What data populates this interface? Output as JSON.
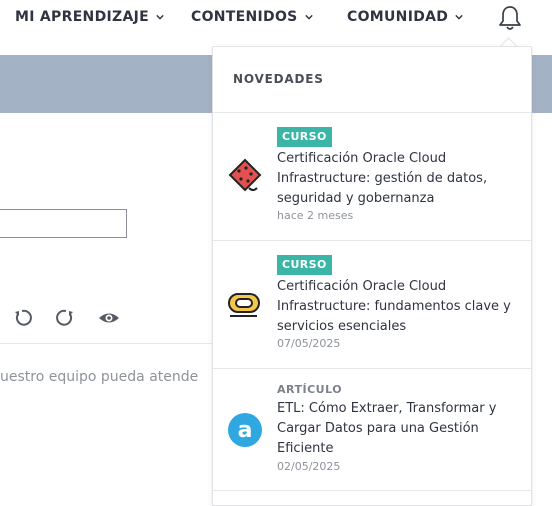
{
  "nav": {
    "items": [
      {
        "label": "MI APRENDIZAJE"
      },
      {
        "label": "CONTENIDOS"
      },
      {
        "label": "COMUNIDAD"
      }
    ],
    "bell_icon": "bell-icon"
  },
  "background": {
    "body_text": "uestro equipo pueda atende",
    "toolbar_icons": [
      "undo-icon",
      "redo-icon",
      "eye-icon"
    ]
  },
  "notifications": {
    "title": "NOVEDADES",
    "items": [
      {
        "type": "CURSO",
        "title": "Certificación Oracle Cloud Infrastructure: gestión de datos, seguridad y gobernanza",
        "date": "hace 2 meses",
        "icon": "oracle-data-icon"
      },
      {
        "type": "CURSO",
        "title": "Certificación Oracle Cloud Infrastructure: fundamentos clave y servicios esenciales",
        "date": "07/05/2025",
        "icon": "oracle-cloud-icon"
      },
      {
        "type": "ARTÍCULO",
        "title": "ETL: Cómo Extraer, Transformar y Cargar Datos para una Gestión Eficiente",
        "date": "02/05/2025",
        "icon": "article-a-icon"
      }
    ]
  },
  "colors": {
    "badge": "#3bb5a6",
    "banner": "#a4b2c5",
    "article_icon": "#2fa7e1"
  }
}
